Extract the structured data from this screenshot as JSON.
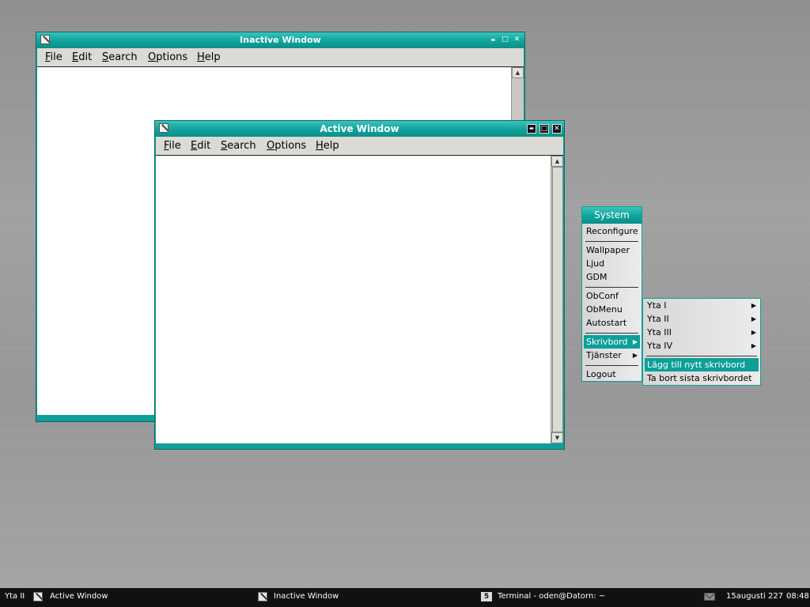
{
  "inactive_window": {
    "title": "Inactive Window",
    "menu": [
      {
        "underline": "F",
        "rest": "ile"
      },
      {
        "underline": "E",
        "rest": "dit"
      },
      {
        "underline": "S",
        "rest": "earch"
      },
      {
        "underline": "O",
        "rest": "ptions"
      },
      {
        "underline": "H",
        "rest": "elp"
      }
    ],
    "buttons": {
      "minimize": "▬",
      "maximize": "□",
      "close": "✕"
    }
  },
  "active_window": {
    "title": "Active Window",
    "menu": [
      {
        "underline": "F",
        "rest": "ile"
      },
      {
        "underline": "E",
        "rest": "dit"
      },
      {
        "underline": "S",
        "rest": "earch"
      },
      {
        "underline": "O",
        "rest": "ptions"
      },
      {
        "underline": "H",
        "rest": "elp"
      }
    ],
    "buttons": {
      "minimize": "▬",
      "maximize": "□",
      "close": "✕"
    },
    "scroll": {
      "up": "▲",
      "down": "▼"
    }
  },
  "system_menu": {
    "header": "System",
    "items": [
      "Reconfigure",
      "Wallpaper",
      "Ljud",
      "GDM",
      "ObConf",
      "ObMenu",
      "Autostart",
      "Skrivbord",
      "Tjänster",
      "Logout"
    ],
    "submenu_arrow": "▶"
  },
  "desktop_submenu": {
    "items": [
      "Yta I",
      "Yta II",
      "Yta III",
      "Yta IV"
    ],
    "actions": [
      "Lägg till nytt skrivbord",
      "Ta bort sista skrivbordet"
    ]
  },
  "taskbar": {
    "desktop_name": "Yta II",
    "tasks": [
      "Active Window",
      "Inactive Window",
      "Terminal - oden@Datorn: ~"
    ],
    "terminal_icon_glyph": "5",
    "date": "15augusti 227",
    "time": "08:48"
  },
  "colors": {
    "accent": "#0e9f99",
    "taskbar": "#111111"
  }
}
